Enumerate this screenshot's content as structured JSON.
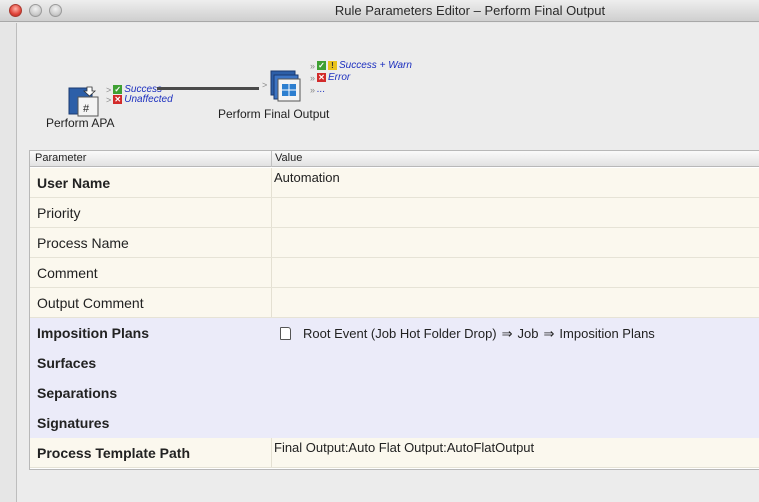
{
  "window": {
    "title": "Rule Parameters Editor – Perform Final Output"
  },
  "icons": {
    "close": "close-dot",
    "minimize": "minimize-dot",
    "maximize": "maximize-dot",
    "source_node": "perform-apa-icon",
    "target_node": "perform-final-output-icon"
  },
  "diagram": {
    "source": {
      "label": "Perform APA",
      "outcomes": [
        "Success",
        "Unaffected"
      ]
    },
    "target": {
      "label": "Perform Final Output",
      "outcomes": [
        "Success + Warn",
        "Error",
        "..."
      ]
    }
  },
  "table": {
    "headers": {
      "parameter": "Parameter",
      "value": "Value"
    },
    "rows": [
      {
        "name": "User Name",
        "value": "Automation",
        "bold": true
      },
      {
        "name": "Priority",
        "value": "",
        "bold": false
      },
      {
        "name": "Process Name",
        "value": "",
        "bold": false
      },
      {
        "name": "Comment",
        "value": "",
        "bold": false
      },
      {
        "name": "Output Comment",
        "value": "",
        "bold": false
      },
      {
        "name": "Imposition Plans",
        "value_parts": [
          "Root Event (Job Hot Folder Drop)",
          "Job",
          "Imposition Plans"
        ],
        "bold": true
      },
      {
        "name": "Surfaces",
        "value": "",
        "bold": true
      },
      {
        "name": "Separations",
        "value": "",
        "bold": true
      },
      {
        "name": "Signatures",
        "value": "",
        "bold": true
      },
      {
        "name": "Process Template Path",
        "value": "Final Output:Auto Flat Output:AutoFlatOutput",
        "bold": true
      }
    ]
  },
  "colors": {
    "outcome_text": "#1c2fbf",
    "row_beige": "#fbf8ee",
    "row_lavender": "#ebebf9",
    "close_red": "#e0443a"
  }
}
